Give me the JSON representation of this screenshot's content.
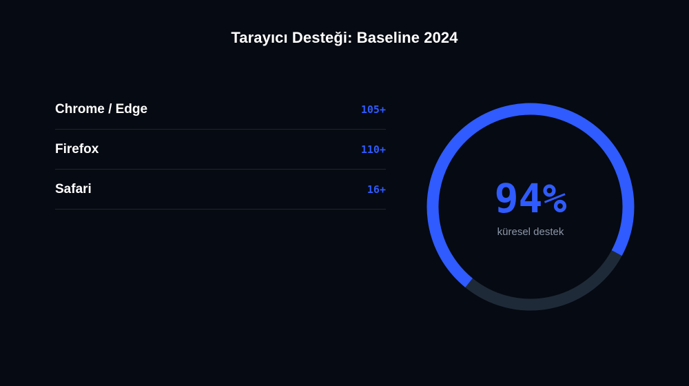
{
  "title": "Tarayıcı Desteği: Baseline 2024",
  "browsers": [
    {
      "name": "Chrome / Edge",
      "version": "105+"
    },
    {
      "name": "Firefox",
      "version": "110+"
    },
    {
      "name": "Safari",
      "version": "16+"
    }
  ],
  "gauge": {
    "value_text": "94%",
    "label": "küresel destek"
  },
  "colors": {
    "background": "#060a12",
    "accent": "#2f5bff",
    "track": "#1f2a38",
    "divider": "#1f2633",
    "muted_text": "#8b96a8"
  },
  "chart_data": {
    "type": "pie",
    "title": "",
    "categories": [
      "küresel destek",
      ""
    ],
    "values": [
      72,
      28
    ],
    "colors": [
      "#2f5bff",
      "#1f2a38"
    ]
  }
}
